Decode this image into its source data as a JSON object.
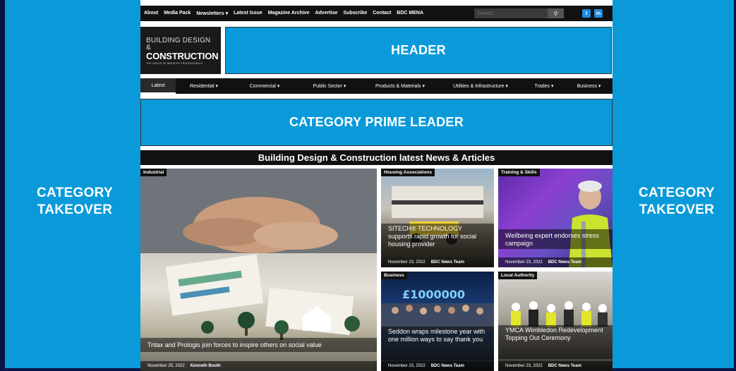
{
  "takeover": {
    "left": "CATEGORY\nTAKEOVER",
    "right": "CATEGORY\nTAKEOVER"
  },
  "topnav": [
    "About",
    "Media Pack",
    "Newsletters ▾",
    "Latest Issue",
    "Magazine Archive",
    "Advertise",
    "Subscribe",
    "Contact",
    "BDC MENA"
  ],
  "search": {
    "placeholder": "Search..."
  },
  "social": {
    "twitter": "t",
    "linkedin": "in"
  },
  "logo": {
    "line1": "BUILDING DESIGN &",
    "line2": "CONSTRUCTION",
    "line3": "THE CHOICE OF INDUSTRY PROFESSIONALS"
  },
  "header_label": "HEADER",
  "catnav": [
    "Latest",
    "Residential ▾",
    "Commercial ▾",
    "Public Sector ▾",
    "Products & Materials ▾",
    "Utilities & Infrastructure ▾",
    "Trades ▾",
    "Business ▾"
  ],
  "prime_label": "CATEGORY PRIME LEADER",
  "news_heading": "Building Design & Construction latest News & Articles",
  "articles": [
    {
      "tag": "Industrial",
      "title": "Tritax and Prologis join forces to inspire others on social value",
      "date": "November 25, 2022",
      "author": "Kenneth Booth"
    },
    {
      "tag": "Housing Associations",
      "title": "SITECH® TECHNOLOGY supports rapid growth for social housing provider",
      "date": "November 23, 2022",
      "author": "BDC News Team"
    },
    {
      "tag": "Training & Skills",
      "title": "Wellbeing expert endorses stress campaign",
      "date": "November 23, 2022",
      "author": "BDC News Team"
    },
    {
      "tag": "Business",
      "title": "Seddon wraps milestone year with one million ways to say thank you",
      "date": "November 23, 2022",
      "author": "BDC News Team"
    },
    {
      "tag": "Local Authority",
      "title": "YMCA Wimbledon Redevelopment Topping Out Ceremony",
      "date": "November 23, 2022",
      "author": "BDC News Team"
    }
  ],
  "colors": {
    "accent": "#0a9ad9",
    "bar": "#111111",
    "background": "#0b1446"
  }
}
